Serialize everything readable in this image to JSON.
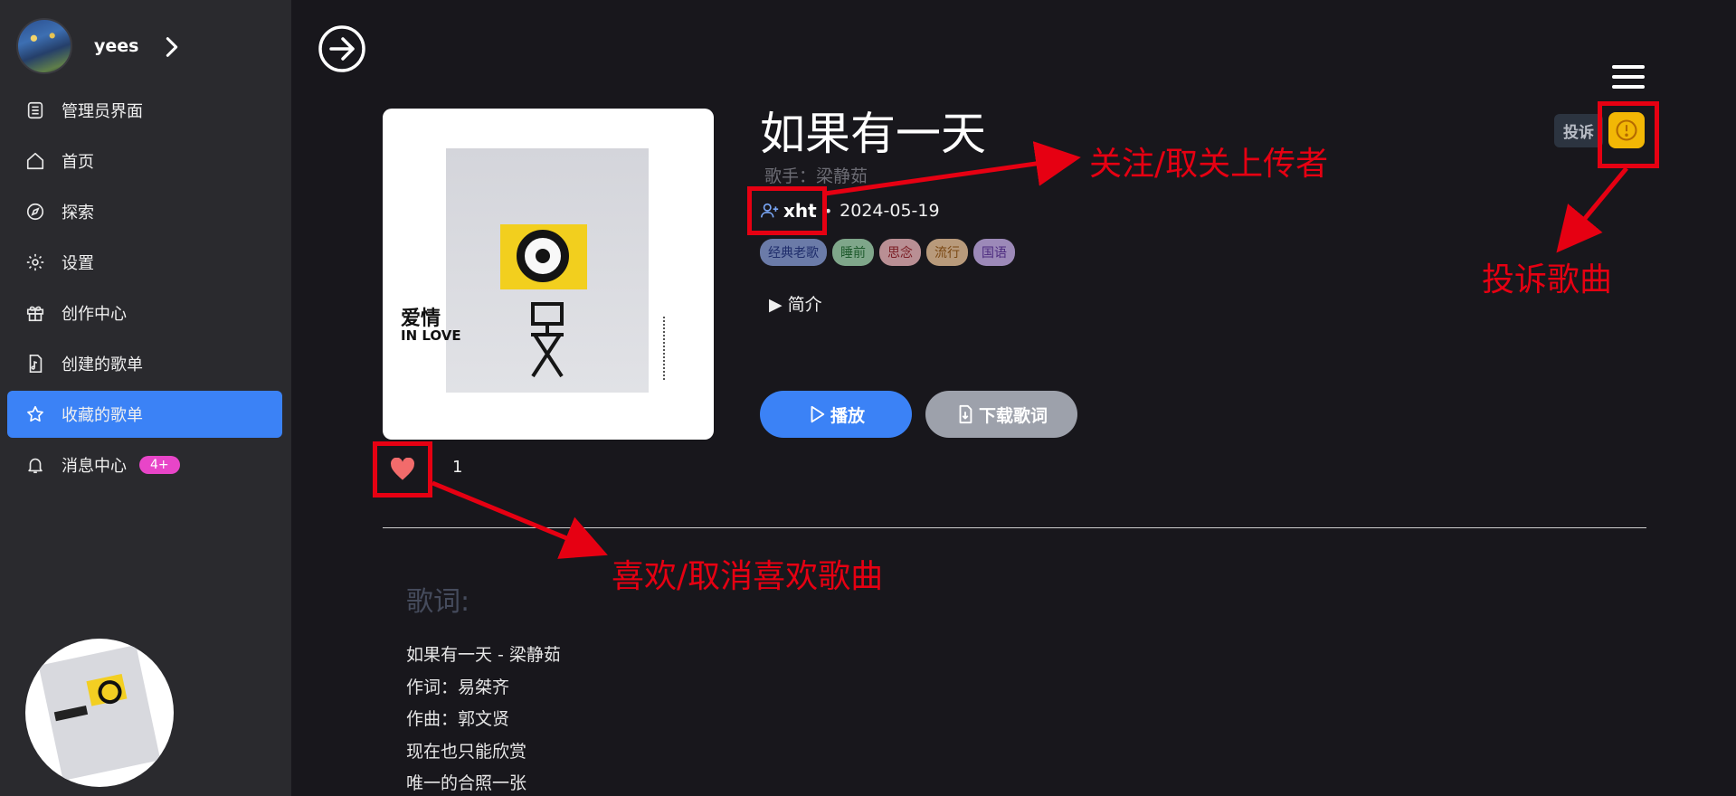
{
  "sidebar": {
    "username": "yees",
    "items": [
      {
        "label": "管理员界面",
        "icon": "list-icon"
      },
      {
        "label": "首页",
        "icon": "home-icon"
      },
      {
        "label": "探索",
        "icon": "compass-icon"
      },
      {
        "label": "设置",
        "icon": "gear-icon"
      },
      {
        "label": "创作中心",
        "icon": "gift-icon"
      },
      {
        "label": "创建的歌单",
        "icon": "music-file-icon"
      },
      {
        "label": "收藏的歌单",
        "icon": "star-icon",
        "active": true
      },
      {
        "label": "消息中心",
        "icon": "bell-icon",
        "badge": "4+"
      }
    ]
  },
  "cover": {
    "title_a": "爱情",
    "title_b": "IN LOVE"
  },
  "song": {
    "title": "如果有一天",
    "singer": "歌手：梁静茹",
    "uploader": "xht",
    "date": "2024-05-19",
    "tags": [
      {
        "label": "经典老歌",
        "bg": "#6b7ba8",
        "color": "#1f2d6b"
      },
      {
        "label": "睡前",
        "bg": "#7fa68a",
        "color": "#1e5a2c"
      },
      {
        "label": "思念",
        "bg": "#b98f94",
        "color": "#7a1d24"
      },
      {
        "label": "流行",
        "bg": "#b89a7b",
        "color": "#7a4813"
      },
      {
        "label": "国语",
        "bg": "#9c89b8",
        "color": "#4c2a7e"
      }
    ],
    "intro_label": "▶ 简介",
    "like_count": "1"
  },
  "actions": {
    "play_label": "播放",
    "download_label": "下载歌词",
    "report_label": "投诉"
  },
  "lyrics": {
    "title": "歌词:",
    "lines": [
      "如果有一天 - 梁静茹",
      "作词：易桀齐",
      "作曲：郭文贤",
      "现在也只能欣赏",
      "唯一的合照一张"
    ]
  },
  "annotations": {
    "follow": "关注/取关上传者",
    "report": "投诉歌曲",
    "like": "喜欢/取消喜欢歌曲"
  },
  "colors": {
    "accent": "#3b82f6",
    "annotation": "#e60012",
    "badge": "#e845c8",
    "report": "#f2b705"
  }
}
